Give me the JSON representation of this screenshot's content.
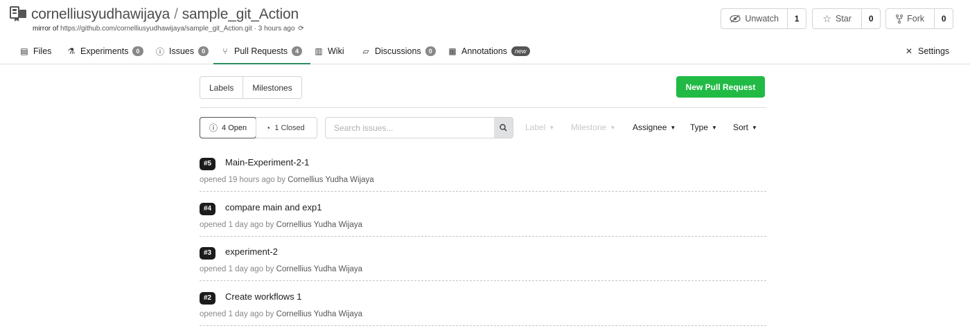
{
  "repo": {
    "owner": "cornelliusyudhawijaya",
    "separator": "/",
    "name": "sample_git_Action",
    "mirror_prefix": "mirror of",
    "mirror_url": "https://github.com/cornelliusyudhawijaya/sample_git_Action.git",
    "mirror_ago": "· 3 hours ago",
    "sync_icon": "sync-icon"
  },
  "actions": {
    "watch_label": "Unwatch",
    "watch_count": "1",
    "star_label": "Star",
    "star_count": "0",
    "fork_label": "Fork",
    "fork_count": "0"
  },
  "tabs": [
    {
      "label": "Files",
      "icon": "file-icon",
      "badge": ""
    },
    {
      "label": "Experiments",
      "icon": "flask-icon",
      "badge": "0"
    },
    {
      "label": "Issues",
      "icon": "issue-icon",
      "badge": "0"
    },
    {
      "label": "Pull Requests",
      "icon": "pull-request-icon",
      "badge": "4",
      "active": true
    },
    {
      "label": "Wiki",
      "icon": "book-icon",
      "badge": ""
    },
    {
      "label": "Discussions",
      "icon": "comments-icon",
      "badge": "0"
    },
    {
      "label": "Annotations",
      "icon": "annotation-icon",
      "badge": "new"
    },
    {
      "label": "Settings",
      "icon": "tools-icon",
      "badge": ""
    }
  ],
  "toolbar": {
    "labels_label": "Labels",
    "milestones_label": "Milestones",
    "new_pr_label": "New Pull Request"
  },
  "filters": {
    "open_label": "4 Open",
    "closed_label": "1 Closed",
    "search_placeholder": "Search issues...",
    "label": "Label",
    "milestone": "Milestone",
    "assignee": "Assignee",
    "type": "Type",
    "sort": "Sort"
  },
  "pull_requests": [
    {
      "number": "#5",
      "title": "Main-Experiment-2-1",
      "opened": "opened 19 hours ago by",
      "author": "Cornellius Yudha Wijaya"
    },
    {
      "number": "#4",
      "title": "compare main and exp1",
      "opened": "opened 1 day ago by",
      "author": "Cornellius Yudha Wijaya"
    },
    {
      "number": "#3",
      "title": "experiment-2",
      "opened": "opened 1 day ago by",
      "author": "Cornellius Yudha Wijaya"
    },
    {
      "number": "#2",
      "title": "Create workflows 1",
      "opened": "opened 1 day ago by",
      "author": "Cornellius Yudha Wijaya"
    }
  ]
}
